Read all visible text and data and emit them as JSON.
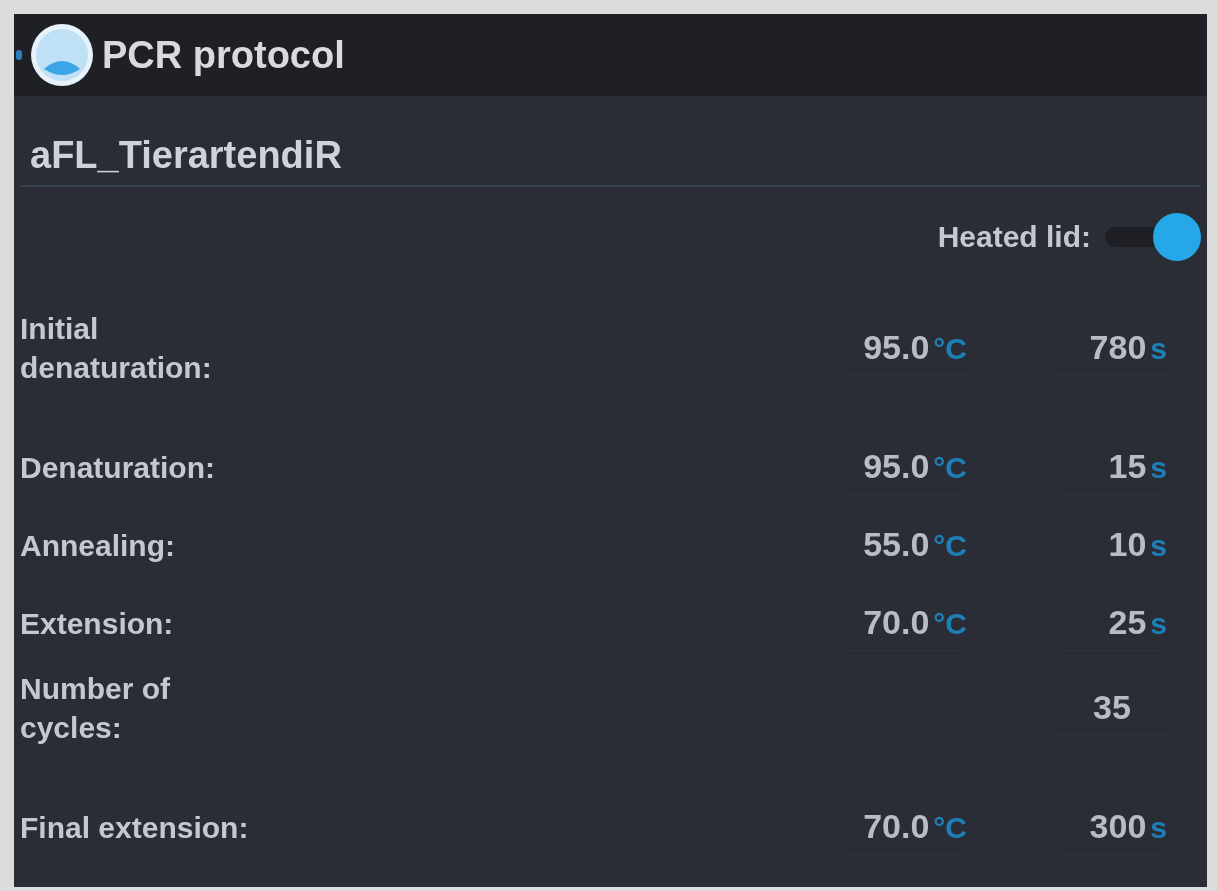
{
  "title_bar": {
    "title": "PCR protocol"
  },
  "protocol_name": "aFL_TierartendiR",
  "heated_lid": {
    "label": "Heated lid:",
    "on": true
  },
  "sections": [
    {
      "rows": [
        {
          "kind": "step",
          "label": "Initial denaturation:",
          "temperature": "95.0",
          "temperature_unit": "°C",
          "time": "780",
          "time_unit": "s"
        }
      ]
    },
    {
      "rows": [
        {
          "kind": "step",
          "label": "Denaturation:",
          "temperature": "95.0",
          "temperature_unit": "°C",
          "time": "15",
          "time_unit": "s"
        },
        {
          "kind": "step",
          "label": "Annealing:",
          "temperature": "55.0",
          "temperature_unit": "°C",
          "time": "10",
          "time_unit": "s"
        },
        {
          "kind": "step",
          "label": "Extension:",
          "temperature": "70.0",
          "temperature_unit": "°C",
          "time": "25",
          "time_unit": "s"
        },
        {
          "kind": "count",
          "label": "Number of cycles:",
          "value": "35"
        }
      ]
    },
    {
      "rows": [
        {
          "kind": "step",
          "label": "Final extension:",
          "temperature": "70.0",
          "temperature_unit": "°C",
          "time": "300",
          "time_unit": "s"
        }
      ]
    }
  ]
}
